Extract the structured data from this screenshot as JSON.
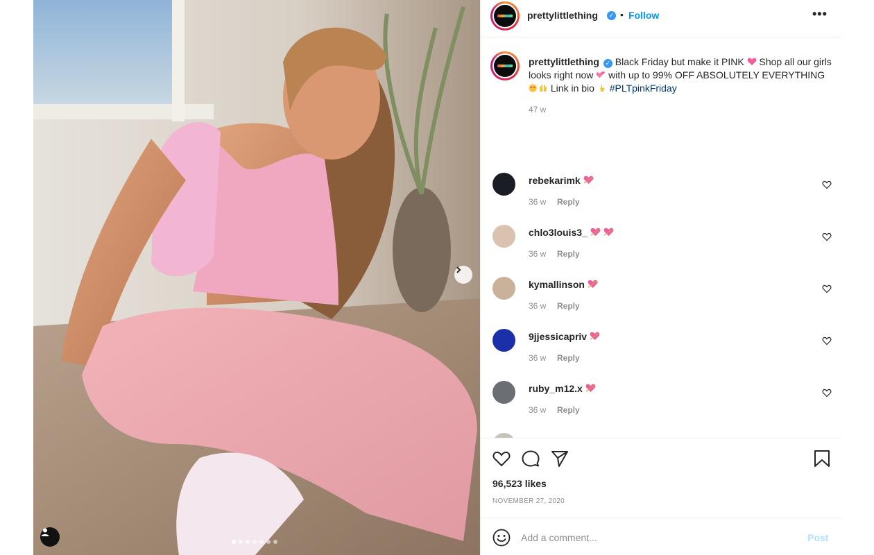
{
  "post": {
    "username": "prettylittlething",
    "verified": true,
    "follow_label": "Follow",
    "bullet": "•",
    "more_label": "•••"
  },
  "photo": {
    "carousel_total": 7,
    "carousel_current": 1,
    "next_icon": "chevron-right-icon",
    "tag_icon": "user-tag-icon"
  },
  "caption": {
    "username": "prettylittlething",
    "part1": "Black Friday but make it PINK",
    "part2": "Shop all our girls looks right now",
    "part3": "with up to 99% OFF ABSOLUTELY EVERYTHING",
    "part4": "Link in bio",
    "hashtag": "#PLTpinkFriday",
    "time": "47 w"
  },
  "comments": [
    {
      "user": "rebekarimk",
      "time": "36 w",
      "reply": "Reply",
      "hearts": 1,
      "avatar": "#1a1d24"
    },
    {
      "user": "chlo3louis3_",
      "time": "36 w",
      "reply": "Reply",
      "hearts": 2,
      "avatar": "#d9c2b0"
    },
    {
      "user": "kymallinson",
      "time": "36 w",
      "reply": "Reply",
      "hearts": 1,
      "avatar": "#c9b19a"
    },
    {
      "user": "9jjessicapriv",
      "time": "36 w",
      "reply": "Reply",
      "hearts": 1,
      "avatar": "#1b2fa8"
    },
    {
      "user": "ruby_m12.x",
      "time": "36 w",
      "reply": "Reply",
      "hearts": 1,
      "avatar": "#6b6f74"
    }
  ],
  "stats": {
    "likes": "96,523 likes",
    "date": "NOVEMBER 27, 2020"
  },
  "add_comment": {
    "placeholder": "Add a comment...",
    "post_label": "Post"
  },
  "colors": {
    "link_blue": "#0095f6",
    "hashtag_blue": "#00376b",
    "muted_gray": "#8e8e8e",
    "post_disabled": "#b2dffc"
  }
}
